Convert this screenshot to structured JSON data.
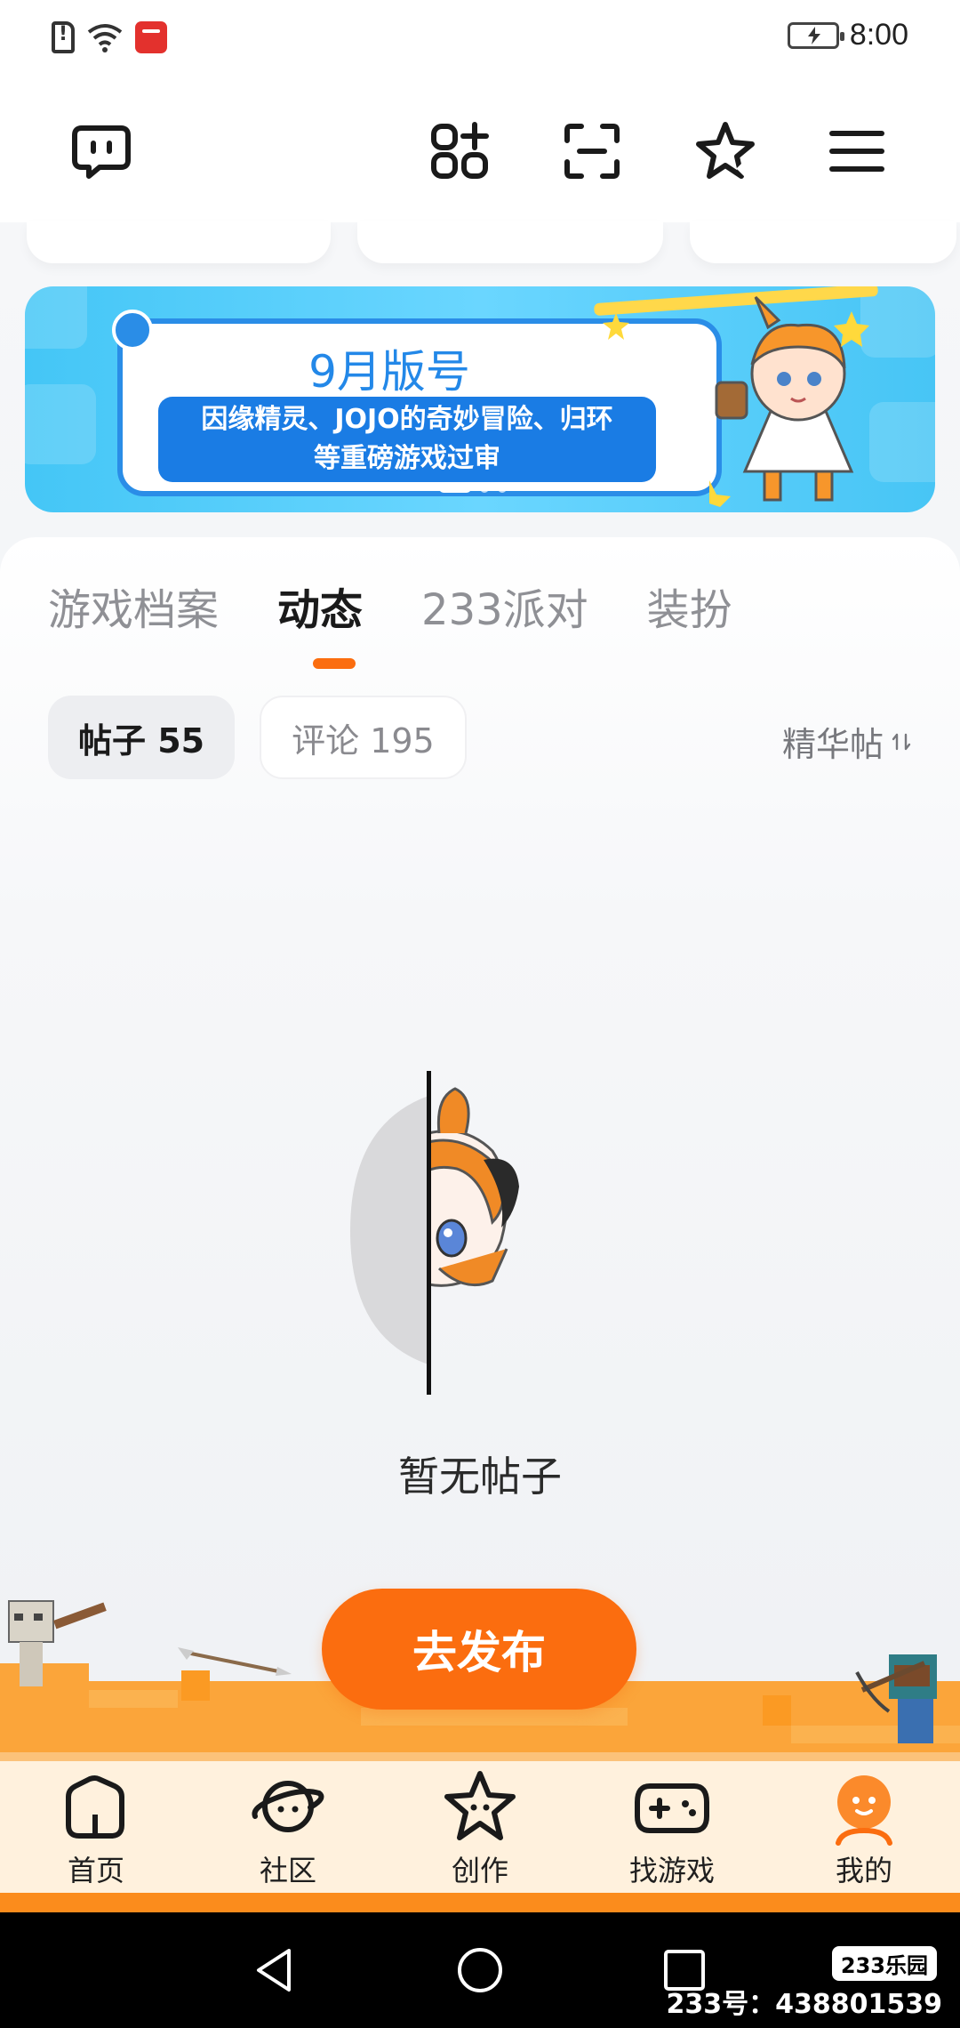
{
  "status_bar": {
    "time": "8:00",
    "icons": [
      "sim-alert-icon",
      "wifi-icon",
      "app-notification-icon",
      "battery-charging-icon"
    ]
  },
  "toolbar": {
    "icons": [
      "message-bubble-icon",
      "add-widget-icon",
      "scan-icon",
      "star-sparkle-icon",
      "menu-icon"
    ]
  },
  "banner": {
    "title": "9月版号",
    "subtitle_line1": "因缘精灵、JOJO的奇妙冒险、归环",
    "subtitle_line2": "等重磅游戏过审",
    "page_count": 3,
    "active_page": 1
  },
  "tabs": [
    {
      "label": "游戏档案",
      "active": false
    },
    {
      "label": "动态",
      "active": true
    },
    {
      "label": "233派对",
      "active": false
    },
    {
      "label": "装扮",
      "active": false
    }
  ],
  "filters": {
    "posts_label": "帖子 55",
    "comments_label": "评论 195",
    "sort_label": "精华帖",
    "sort_icon": "sort-toggle-icon"
  },
  "empty_state": {
    "message": "暂无帖子"
  },
  "publish_button": {
    "label": "去发布"
  },
  "bottom_nav": [
    {
      "label": "首页",
      "icon": "home-icon",
      "active": false
    },
    {
      "label": "社区",
      "icon": "planet-icon",
      "active": false
    },
    {
      "label": "创作",
      "icon": "star-face-icon",
      "active": false
    },
    {
      "label": "找游戏",
      "icon": "gamepad-icon",
      "active": false
    },
    {
      "label": "我的",
      "icon": "profile-face-icon",
      "active": true
    }
  ],
  "watermark": {
    "logo": "233乐园",
    "id_text": "233号：438801539"
  },
  "colors": {
    "accent": "#fb6d0f",
    "banner_blue": "#2a8de7",
    "nav_bg": "#fff1dd"
  }
}
